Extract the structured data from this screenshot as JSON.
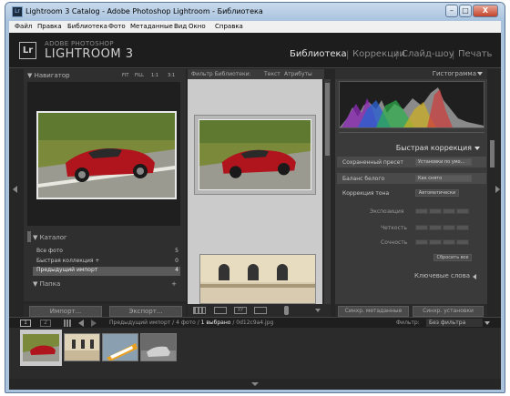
{
  "window": {
    "title": "Lightroom 3 Catalog - Adobe Photoshop Lightroom - Библиотека",
    "minimize": "–",
    "maximize": "□",
    "close": "X"
  },
  "menubar": [
    "Файл",
    "Правка",
    "Библиотека",
    "Фото",
    "Метаданные",
    "Вид",
    "Окно",
    "Справка"
  ],
  "header": {
    "logo": "Lr",
    "brand_top": "ADOBE PHOTOSHOP",
    "brand": "LIGHTROOM 3",
    "modules": [
      "Библиотека",
      "Коррекции",
      "Слайд-шоу",
      "Печать"
    ],
    "module_sep": "|"
  },
  "navigator": {
    "title": "Навигатор",
    "zoom": [
      "FIT",
      "FILL",
      "1:1",
      "3:1"
    ]
  },
  "catalog": {
    "title": "Каталог",
    "items": [
      {
        "label": "Все фото",
        "count": "5"
      },
      {
        "label": "Быстрая коллекция +",
        "count": "0"
      },
      {
        "label": "Предыдущий импорт",
        "count": "4"
      }
    ]
  },
  "folders": {
    "title": "Папка",
    "plus": "+"
  },
  "filterbar": {
    "label": "Фильтр Библиотеки:",
    "tabs": [
      "Текст",
      "Атрибуты"
    ]
  },
  "histogram": {
    "title": "Гистограмма"
  },
  "quick": {
    "title": "Быстрая коррекция",
    "preset_label": "Сохраненный пресет",
    "preset_value": "Установки по умо...",
    "wb_label": "Баланс белого",
    "wb_value": "Как снято",
    "tone_label": "Коррекция тона",
    "auto_button": "Автоматически",
    "rows": [
      "Экспозиция",
      "Четкость",
      "Сочность"
    ],
    "reset_button": "Сбросить все"
  },
  "keywords": {
    "title": "Ключевые слова"
  },
  "bottom": {
    "import": "Импорт...",
    "export": "Экспорт...",
    "sync_meta": "Синхр. метаданные",
    "sync_settings": "Синхр. установки"
  },
  "filmbar": {
    "page1": "1",
    "page2": "2",
    "status_prefix": "Предыдущий импорт / 4 фото / ",
    "status_sel": "1 выбрано",
    "status_suffix": " / 0d12c9a4.jpg",
    "filter_label": "Фильтр:",
    "filter_value": "Без фильтра"
  }
}
